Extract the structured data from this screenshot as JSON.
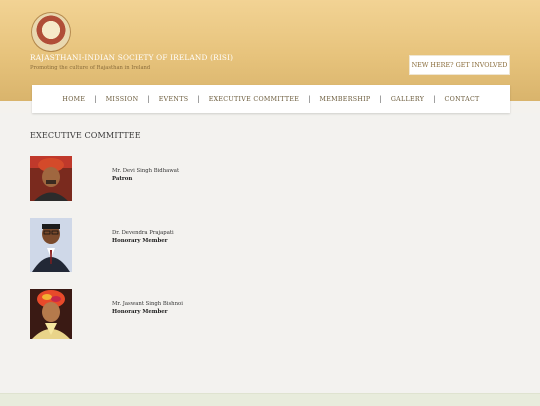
{
  "header": {
    "site_title": "RAJASTHANI-INDIAN SOCIETY OF IRELAND (RISI)",
    "tagline": "Promoting the culture of Rajasthan in Ireland",
    "cta_label": "NEW HERE? GET INVOLVED"
  },
  "nav": {
    "items": [
      {
        "label": "HOME"
      },
      {
        "label": "MISSION"
      },
      {
        "label": "EVENTS"
      },
      {
        "label": "EXECUTIVE COMMITTEE"
      },
      {
        "label": "MEMBERSHIP"
      },
      {
        "label": "GALLERY"
      },
      {
        "label": "CONTACT"
      }
    ],
    "separator": "|"
  },
  "main": {
    "section_title": "EXECUTIVE COMMITTEE",
    "members": [
      {
        "name": "Mr. Devi Singh Bidhawat",
        "role": "Patron"
      },
      {
        "name": "Dr. Devendra Prajapati",
        "role": "Honorary Member"
      },
      {
        "name": "Mr. Jaswant Singh Bishnoi",
        "role": "Honorary Member"
      }
    ]
  },
  "colors": {
    "header_gold": "#e7c37c",
    "nav_text": "#6a5a3a",
    "page_bg": "#f3f2ef"
  }
}
